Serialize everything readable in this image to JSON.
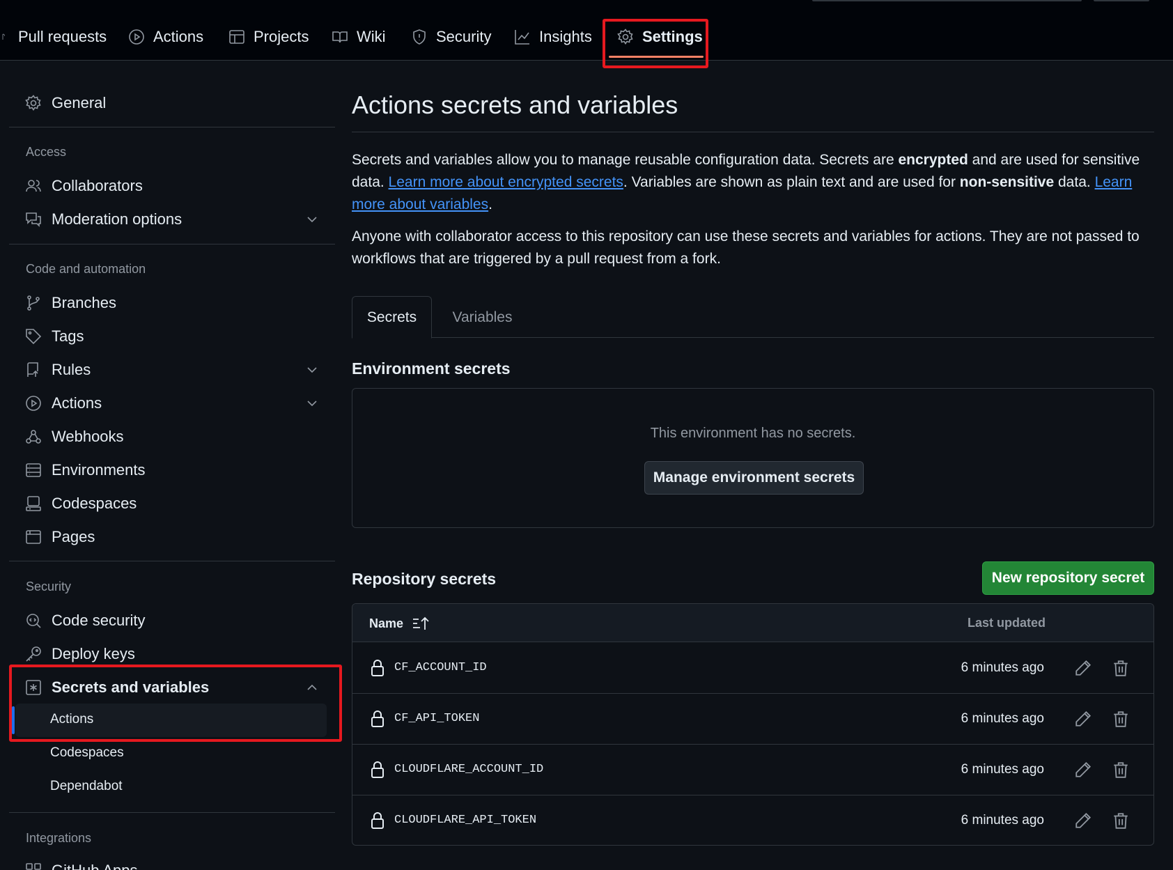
{
  "topnav": {
    "tabs": [
      {
        "label": "Pull requests",
        "icon": "pull-request-icon"
      },
      {
        "label": "Actions",
        "icon": "play-circle-icon"
      },
      {
        "label": "Projects",
        "icon": "table-icon"
      },
      {
        "label": "Wiki",
        "icon": "book-icon"
      },
      {
        "label": "Security",
        "icon": "shield-icon"
      },
      {
        "label": "Insights",
        "icon": "graph-icon"
      },
      {
        "label": "Settings",
        "icon": "gear-icon",
        "active": true
      }
    ]
  },
  "sidebar": {
    "general": "General",
    "access_heading": "Access",
    "collaborators": "Collaborators",
    "moderation": "Moderation options",
    "code_heading": "Code and automation",
    "branches": "Branches",
    "tags": "Tags",
    "rules": "Rules",
    "actions": "Actions",
    "webhooks": "Webhooks",
    "environments": "Environments",
    "codespaces": "Codespaces",
    "pages": "Pages",
    "security_heading": "Security",
    "code_security": "Code security",
    "deploy_keys": "Deploy keys",
    "secrets": "Secrets and variables",
    "sub_actions": "Actions",
    "sub_codespaces": "Codespaces",
    "sub_dependabot": "Dependabot",
    "integrations_heading": "Integrations",
    "github_apps": "GitHub Apps"
  },
  "main": {
    "title": "Actions secrets and variables",
    "p1_a": "Secrets and variables allow you to manage reusable configuration data. Secrets are ",
    "p1_b": "encrypted",
    "p1_c": " and are used for sensitive data. ",
    "p1_link1": "Learn more about encrypted secrets",
    "p1_d": ". Variables are shown as plain text and are used for ",
    "p1_e": "non-sensitive",
    "p1_f": " data. ",
    "p1_link2": "Learn more about variables",
    "p1_g": ".",
    "p2": "Anyone with collaborator access to this repository can use these secrets and variables for actions. They are not passed to workflows that are triggered by a pull request from a fork.",
    "tab_secrets": "Secrets",
    "tab_variables": "Variables",
    "env_heading": "Environment secrets",
    "env_empty": "This environment has no secrets.",
    "env_button": "Manage environment secrets",
    "repo_heading": "Repository secrets",
    "new_button": "New repository secret",
    "col_name": "Name",
    "col_updated": "Last updated",
    "secrets": [
      {
        "name": "CF_ACCOUNT_ID",
        "updated": "6 minutes ago"
      },
      {
        "name": "CF_API_TOKEN",
        "updated": "6 minutes ago"
      },
      {
        "name": "CLOUDFLARE_ACCOUNT_ID",
        "updated": "6 minutes ago"
      },
      {
        "name": "CLOUDFLARE_API_TOKEN",
        "updated": "6 minutes ago"
      }
    ]
  },
  "colors": {
    "accent_link": "#4493f8",
    "primary_button": "#238636",
    "active_tab_underline": "#f78166",
    "highlight_box": "#e5191f"
  }
}
